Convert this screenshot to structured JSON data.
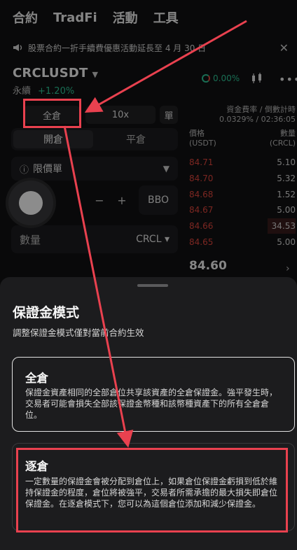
{
  "topnav": {
    "tabs": [
      "合約",
      "TradFi",
      "活動",
      "工具"
    ]
  },
  "banner": {
    "text": "股票合約一折手續費優惠活動延長至 4 月 30 日",
    "close_icon": "close-icon"
  },
  "instrument": {
    "symbol": "CRCLUSDT",
    "type": "永續",
    "change": "+1.20%"
  },
  "toolbar": {
    "percent": "0.00%"
  },
  "order": {
    "margin_mode": "全倉",
    "leverage": "10x",
    "position_mode": "單",
    "open_tab": "開倉",
    "close_tab": "平倉",
    "order_type": "限價單",
    "bbo": "BBO",
    "quantity_label": "數量",
    "quantity_unit": "CRCL"
  },
  "book": {
    "funding_label": "資金費率 / 倒數計時",
    "funding_value": "0.0329% / 02:36:05",
    "price_header": "價格",
    "price_unit": "(USDT)",
    "qty_header": "數量",
    "qty_unit": "(CRCL)",
    "asks": [
      {
        "price": "84.71",
        "qty": "5.10"
      },
      {
        "price": "84.70",
        "qty": "5.32"
      },
      {
        "price": "84.68",
        "qty": "1.52"
      },
      {
        "price": "84.67",
        "qty": "5.00"
      },
      {
        "price": "84.66",
        "qty": "34.53"
      },
      {
        "price": "84.65",
        "qty": "5.00"
      }
    ],
    "last_price": "84.60"
  },
  "sheet": {
    "title": "保證金模式",
    "subtitle": "調整保證金模式僅對當前合約生效",
    "options": [
      {
        "title": "全倉",
        "desc": "保證金資產相同的全部倉位共享該資產的全倉保證金。強平發生時，交易者可能會損失全部該保證金幣種和該幣種資產下的所有全倉倉位。"
      },
      {
        "title": "逐倉",
        "desc": "一定數量的保證金會被分配到倉位上，如果倉位保證金虧損到低於維持保證金的程度，倉位將被強平，交易者所需承擔的最大損失即倉位保證金。在逐倉模式下，您可以為這個倉位添加和減少保證金。"
      }
    ]
  },
  "colors": {
    "ask_red": "#e0463d",
    "up_green": "#2ec99a",
    "annotation_red": "#e9414f"
  }
}
